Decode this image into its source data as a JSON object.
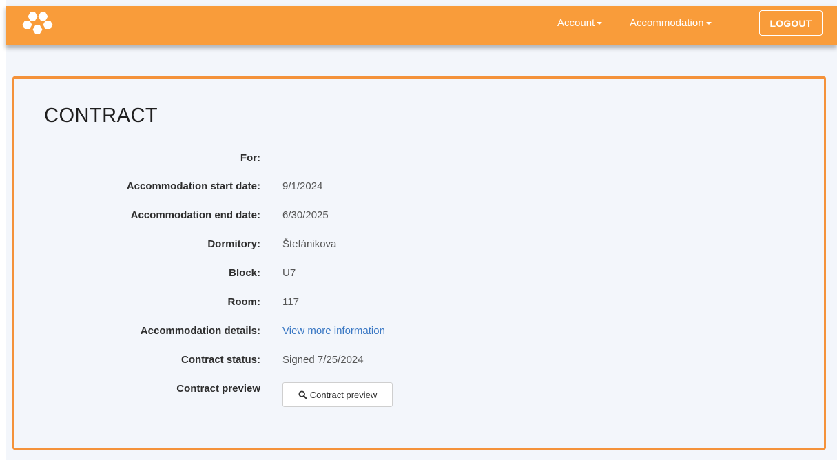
{
  "navbar": {
    "menu": [
      {
        "label": "Account"
      },
      {
        "label": "Accommodation"
      }
    ],
    "logout_label": "LOGOUT",
    "color": "#f99c3a"
  },
  "contract": {
    "title": "CONTRACT",
    "rows": [
      {
        "label": "For:",
        "value": ""
      },
      {
        "label": "Accommodation start date:",
        "value": "9/1/2024"
      },
      {
        "label": "Accommodation end date:",
        "value": "6/30/2025"
      },
      {
        "label": "Dormitory:",
        "value": "Štefánikova"
      },
      {
        "label": "Block:",
        "value": "U7"
      },
      {
        "label": "Room:",
        "value": "117"
      },
      {
        "label": "Accommodation details:",
        "value": "View more information"
      },
      {
        "label": "Contract status:",
        "value": "Signed 7/25/2024"
      },
      {
        "label": "Contract preview",
        "value": ""
      }
    ],
    "preview_button_label": "Contract preview",
    "preview_icon": "search-icon",
    "border_color": "#f4923a",
    "link_color": "#3a78c4"
  }
}
